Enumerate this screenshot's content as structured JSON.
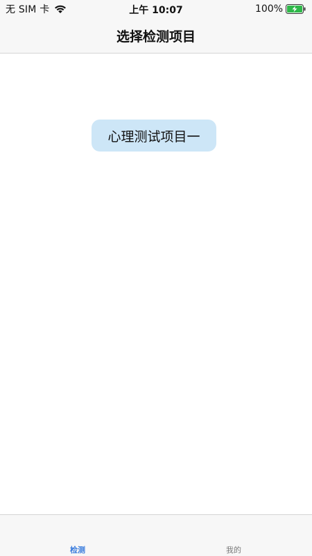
{
  "status_bar": {
    "carrier": "无 SIM 卡",
    "time": "上午 10:07",
    "battery_percent": "100%",
    "icons": {
      "wifi": "wifi-icon",
      "battery": "battery-charging-icon"
    },
    "battery_color": "#2fb84a"
  },
  "nav": {
    "title": "选择检测项目"
  },
  "content": {
    "items": [
      {
        "label": "心理测试项目一"
      }
    ],
    "item_bg_color": "#cde6f7"
  },
  "tab_bar": {
    "tabs": [
      {
        "label": "检测",
        "active": true
      },
      {
        "label": "我的",
        "active": false
      }
    ],
    "active_color": "#3b7ddd",
    "inactive_color": "#7a7a7a"
  }
}
